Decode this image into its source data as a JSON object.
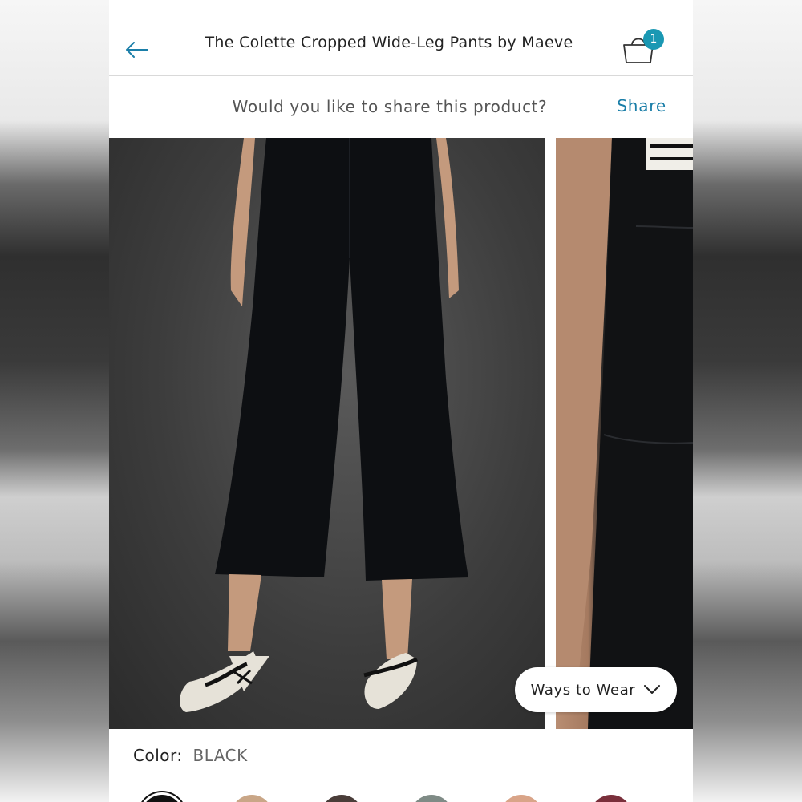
{
  "header": {
    "title": "The Colette Cropped Wide-Leg Pants by Maeve",
    "bag_count": "1",
    "accent_color": "#1a98b3"
  },
  "share": {
    "question": "Would you like to share this product?",
    "link_label": "Share"
  },
  "gallery": {
    "ways_to_wear_label": "Ways to Wear"
  },
  "product": {
    "color_label": "Color:",
    "color_value": "BLACK",
    "swatches": [
      "#111111",
      "#c9a687",
      "#4a3d39",
      "#7f8b86",
      "#d9a488",
      "#7a2f3b"
    ]
  },
  "icons": [
    "back-arrow-icon",
    "shopping-bag-icon",
    "chevron-down-icon"
  ]
}
